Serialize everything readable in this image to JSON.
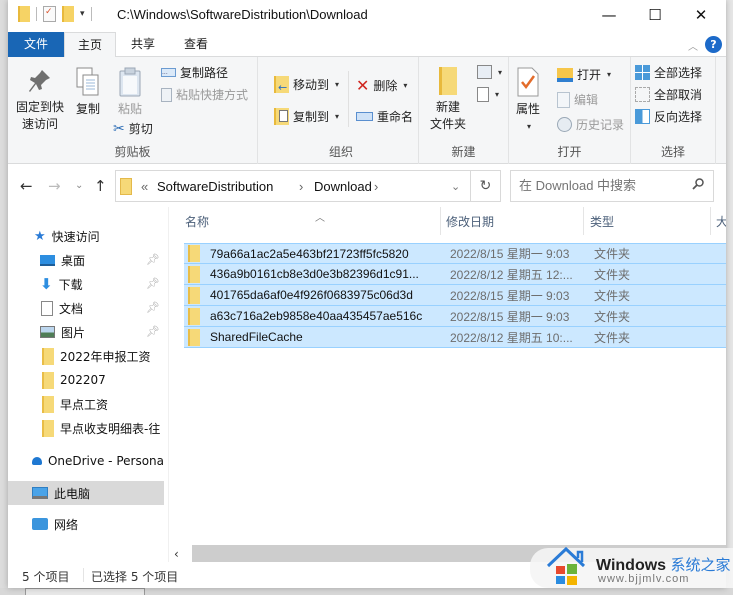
{
  "titlebar": {
    "path": "C:\\Windows\\SoftwareDistribution\\Download",
    "quick_access_toolbar": [
      "folder-icon",
      "properties-icon",
      "new-folder-icon",
      "customize-dropdown"
    ],
    "minimize": "—",
    "maximize": "☐",
    "close": "✕"
  },
  "ribbon_tabs": {
    "file": "文件",
    "home": "主页",
    "share": "共享",
    "view": "查看",
    "active": "主页",
    "help": "?"
  },
  "ribbon": {
    "clipboard": {
      "label": "剪贴板",
      "pin_quick_access": "固定到快速访问",
      "pin_line1": "固定到快",
      "pin_line2": "速访问",
      "copy": "复制",
      "paste": "粘贴",
      "copy_path": "复制路径",
      "paste_shortcut": "粘贴快捷方式",
      "cut": "剪切"
    },
    "organize": {
      "label": "组织",
      "move_to": "移动到",
      "copy_to": "复制到",
      "delete": "删除",
      "rename": "重命名"
    },
    "new": {
      "label": "新建",
      "new_folder_line1": "新建",
      "new_folder_line2": "文件夹"
    },
    "open": {
      "label": "打开",
      "properties": "属性",
      "open": "打开",
      "edit": "编辑",
      "history": "历史记录"
    },
    "select": {
      "label": "选择",
      "select_all": "全部选择",
      "select_none": "全部取消",
      "invert": "反向选择"
    }
  },
  "navbar": {
    "back": "←",
    "forward": "→",
    "recent": "⌄",
    "up": "↑",
    "breadcrumb": [
      "«",
      "SoftwareDistribution",
      "›",
      "Download",
      "›"
    ],
    "dropdown": "⌄",
    "refresh": "↻",
    "search_placeholder": "在 Download 中搜索",
    "search_icon": "⚲"
  },
  "sidebar": {
    "items": [
      {
        "label": "快速访问",
        "icon": "star-icon",
        "pinned": false
      },
      {
        "label": "桌面",
        "icon": "desktop-icon",
        "pinned": true
      },
      {
        "label": "下载",
        "icon": "download-icon",
        "pinned": true
      },
      {
        "label": "文档",
        "icon": "document-icon",
        "pinned": true
      },
      {
        "label": "图片",
        "icon": "pictures-icon",
        "pinned": true
      },
      {
        "label": "2022年申报工资",
        "icon": "folder-icon",
        "pinned": false
      },
      {
        "label": "202207",
        "icon": "folder-icon",
        "pinned": false
      },
      {
        "label": "早点工资",
        "icon": "folder-icon",
        "pinned": false
      },
      {
        "label": "早点收支明细表-往",
        "icon": "folder-icon",
        "pinned": false
      },
      {
        "label": "OneDrive - Persona",
        "icon": "cloud-icon",
        "pinned": false
      },
      {
        "label": "此电脑",
        "icon": "computer-icon",
        "pinned": false,
        "selected": true
      },
      {
        "label": "网络",
        "icon": "network-icon",
        "pinned": false
      }
    ]
  },
  "file_list": {
    "columns": [
      "名称",
      "修改日期",
      "类型",
      "大小"
    ],
    "sort_column": "名称",
    "rows": [
      {
        "name": "79a66a1ac2a5e463bf21723ff5fc5820",
        "date": "2022/8/15 星期一 9:03",
        "type": "文件夹",
        "selected": true
      },
      {
        "name": "436a9b0161cb8e3d0e3b82396d1c91...",
        "date": "2022/8/12 星期五 12:...",
        "type": "文件夹",
        "selected": true
      },
      {
        "name": "401765da6af0e4f926f0683975c06d3d",
        "date": "2022/8/15 星期一 9:03",
        "type": "文件夹",
        "selected": true
      },
      {
        "name": "a63c716a2eb9858e40aa435457ae516c",
        "date": "2022/8/15 星期一 9:03",
        "type": "文件夹",
        "selected": true
      },
      {
        "name": "SharedFileCache",
        "date": "2022/8/12 星期五 10:...",
        "type": "文件夹",
        "selected": true
      }
    ]
  },
  "statusbar": {
    "item_count": "5 个项目",
    "selected_count": "已选择 5 个项目"
  },
  "watermark": {
    "brand": "Windows",
    "brand_cn": "系统之家",
    "url": "www.bjjmlv.com"
  },
  "colors": {
    "accent": "#1966b5",
    "selection": "#cce8ff",
    "selection_border": "#99d1ff",
    "folder": "#f6d978"
  }
}
